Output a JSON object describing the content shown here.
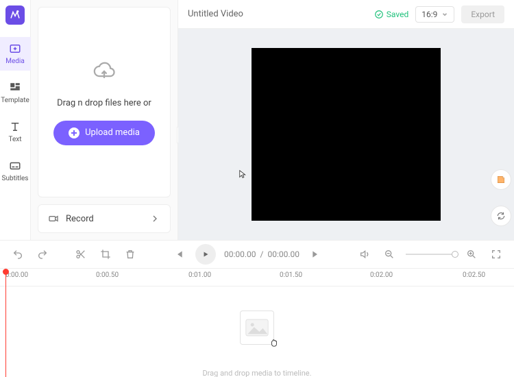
{
  "nav": {
    "items": [
      {
        "key": "media",
        "label": "Media"
      },
      {
        "key": "template",
        "label": "Template"
      },
      {
        "key": "text",
        "label": "Text"
      },
      {
        "key": "subtitles",
        "label": "Subtitles"
      }
    ]
  },
  "mediaPanel": {
    "dropHint": "Drag n drop files here or",
    "uploadLabel": "Upload media",
    "recordLabel": "Record"
  },
  "header": {
    "title": "Untitled Video",
    "savedLabel": "Saved",
    "aspect": "16:9",
    "exportLabel": "Export"
  },
  "playback": {
    "current": "00:00.00",
    "separator": "/",
    "total": "00:00.00"
  },
  "ruler": {
    "ticks": [
      {
        "pos": 8,
        "label": "0:00.00"
      },
      {
        "pos": 140,
        "label": "0:00.50"
      },
      {
        "pos": 275,
        "label": "0:01.00"
      },
      {
        "pos": 408,
        "label": "0:01.50"
      },
      {
        "pos": 540,
        "label": "0:02.00"
      },
      {
        "pos": 675,
        "label": "0:02.50"
      }
    ]
  },
  "timeline": {
    "hint": "Drag and drop media to timeline."
  },
  "icons": {
    "collapse": "‹"
  }
}
